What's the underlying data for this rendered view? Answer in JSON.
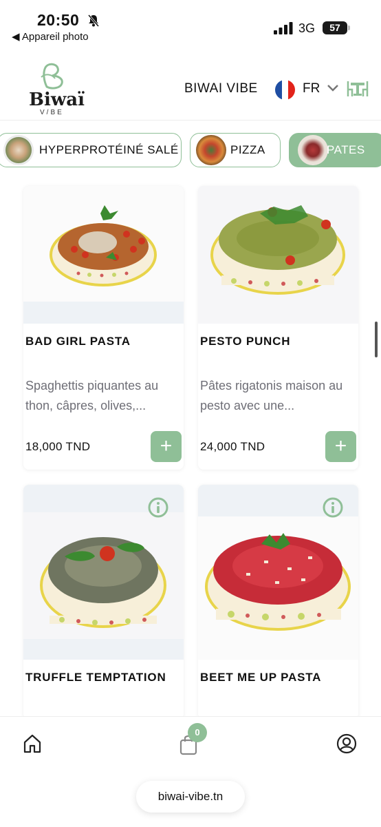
{
  "status_bar": {
    "time": "20:50",
    "back_app": "◀ Appareil photo",
    "network": "3G",
    "battery": "57",
    "icons": [
      "bell-muted-icon",
      "signal-bars-icon",
      "battery-icon"
    ]
  },
  "header": {
    "logo_word": "Biwaï",
    "logo_sub": "V/BE",
    "title": "BIWAI VIBE",
    "language": "FR",
    "flag_colors": [
      "#1f4ea3",
      "#ffffff",
      "#e2231a"
    ],
    "icons": [
      "flag-fr-icon",
      "chevron-down-icon",
      "table-chairs-icon"
    ]
  },
  "categories": [
    {
      "label": "HYPERPROTÉINÉ SALÉ",
      "active": false
    },
    {
      "label": "PIZZA",
      "active": false
    },
    {
      "label": "PATES",
      "active": true
    }
  ],
  "products": [
    {
      "name": "BAD GIRL PASTA",
      "description": "Spaghettis piquantes au thon, câpres, olives,...",
      "price": "18,000 TND",
      "add_label": "+"
    },
    {
      "name": "PESTO PUNCH",
      "description": "Pâtes rigatonis maison au pesto avec une...",
      "price": "24,000 TND",
      "add_label": "+"
    },
    {
      "name": "TRUFFLE TEMPTATION",
      "description": "",
      "price": "",
      "add_label": "+"
    },
    {
      "name": "BEET ME UP PASTA",
      "description": "",
      "price": "",
      "add_label": "+"
    }
  ],
  "bottom_nav": {
    "cart_count": "0",
    "icons": [
      "home-icon",
      "shopping-bag-icon",
      "user-icon"
    ]
  },
  "browser": {
    "url": "biwai-vibe.tn"
  },
  "colors": {
    "accent": "#8fbf97",
    "text": "#111111",
    "muted_text": "#6e6e76",
    "image_bg": "#eef2f6"
  }
}
